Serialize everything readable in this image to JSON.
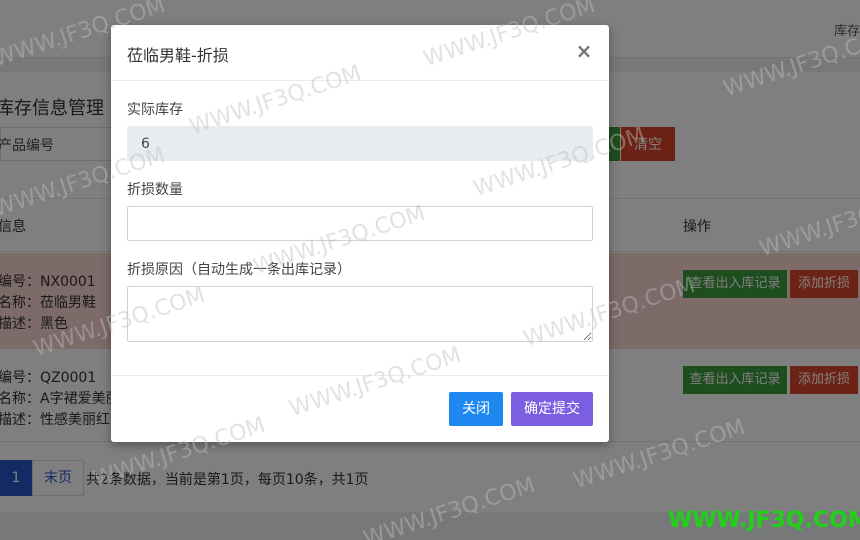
{
  "background": {
    "topbar_right": "库存",
    "page_title": "库存信息管理",
    "search_label": "产品编号",
    "clear_button": "清空",
    "table_headers": {
      "info": "信息",
      "operation": "操作"
    },
    "rows": [
      {
        "code": "编号：NX0001",
        "name": "名称：莅临男鞋",
        "desc": "描述：黑色",
        "view_button": "查看出入库记录",
        "loss_button": "添加折损"
      },
      {
        "code": "编号：QZ0001",
        "name": "名称：A字裙爱美丽",
        "desc": "描述：性感美丽红色",
        "view_button": "查看出入库记录",
        "loss_button": "添加折损"
      }
    ],
    "pagination": {
      "current_page": "1",
      "last_label": "末页",
      "info": "共2条数据，当前是第1页，每页10条，共1页"
    }
  },
  "modal": {
    "title": "莅临男鞋-折损",
    "close_symbol": "×",
    "stock_label": "实际库存",
    "stock_value": "6",
    "qty_label": "折损数量",
    "qty_value": "",
    "reason_label": "折损原因（自动生成一条出库记录）",
    "reason_value": "",
    "close_button": "关闭",
    "submit_button": "确定提交"
  },
  "watermark": {
    "text": "WWW.JF3Q.COM",
    "corner_text": "WWW.JF3Q.COM"
  }
}
